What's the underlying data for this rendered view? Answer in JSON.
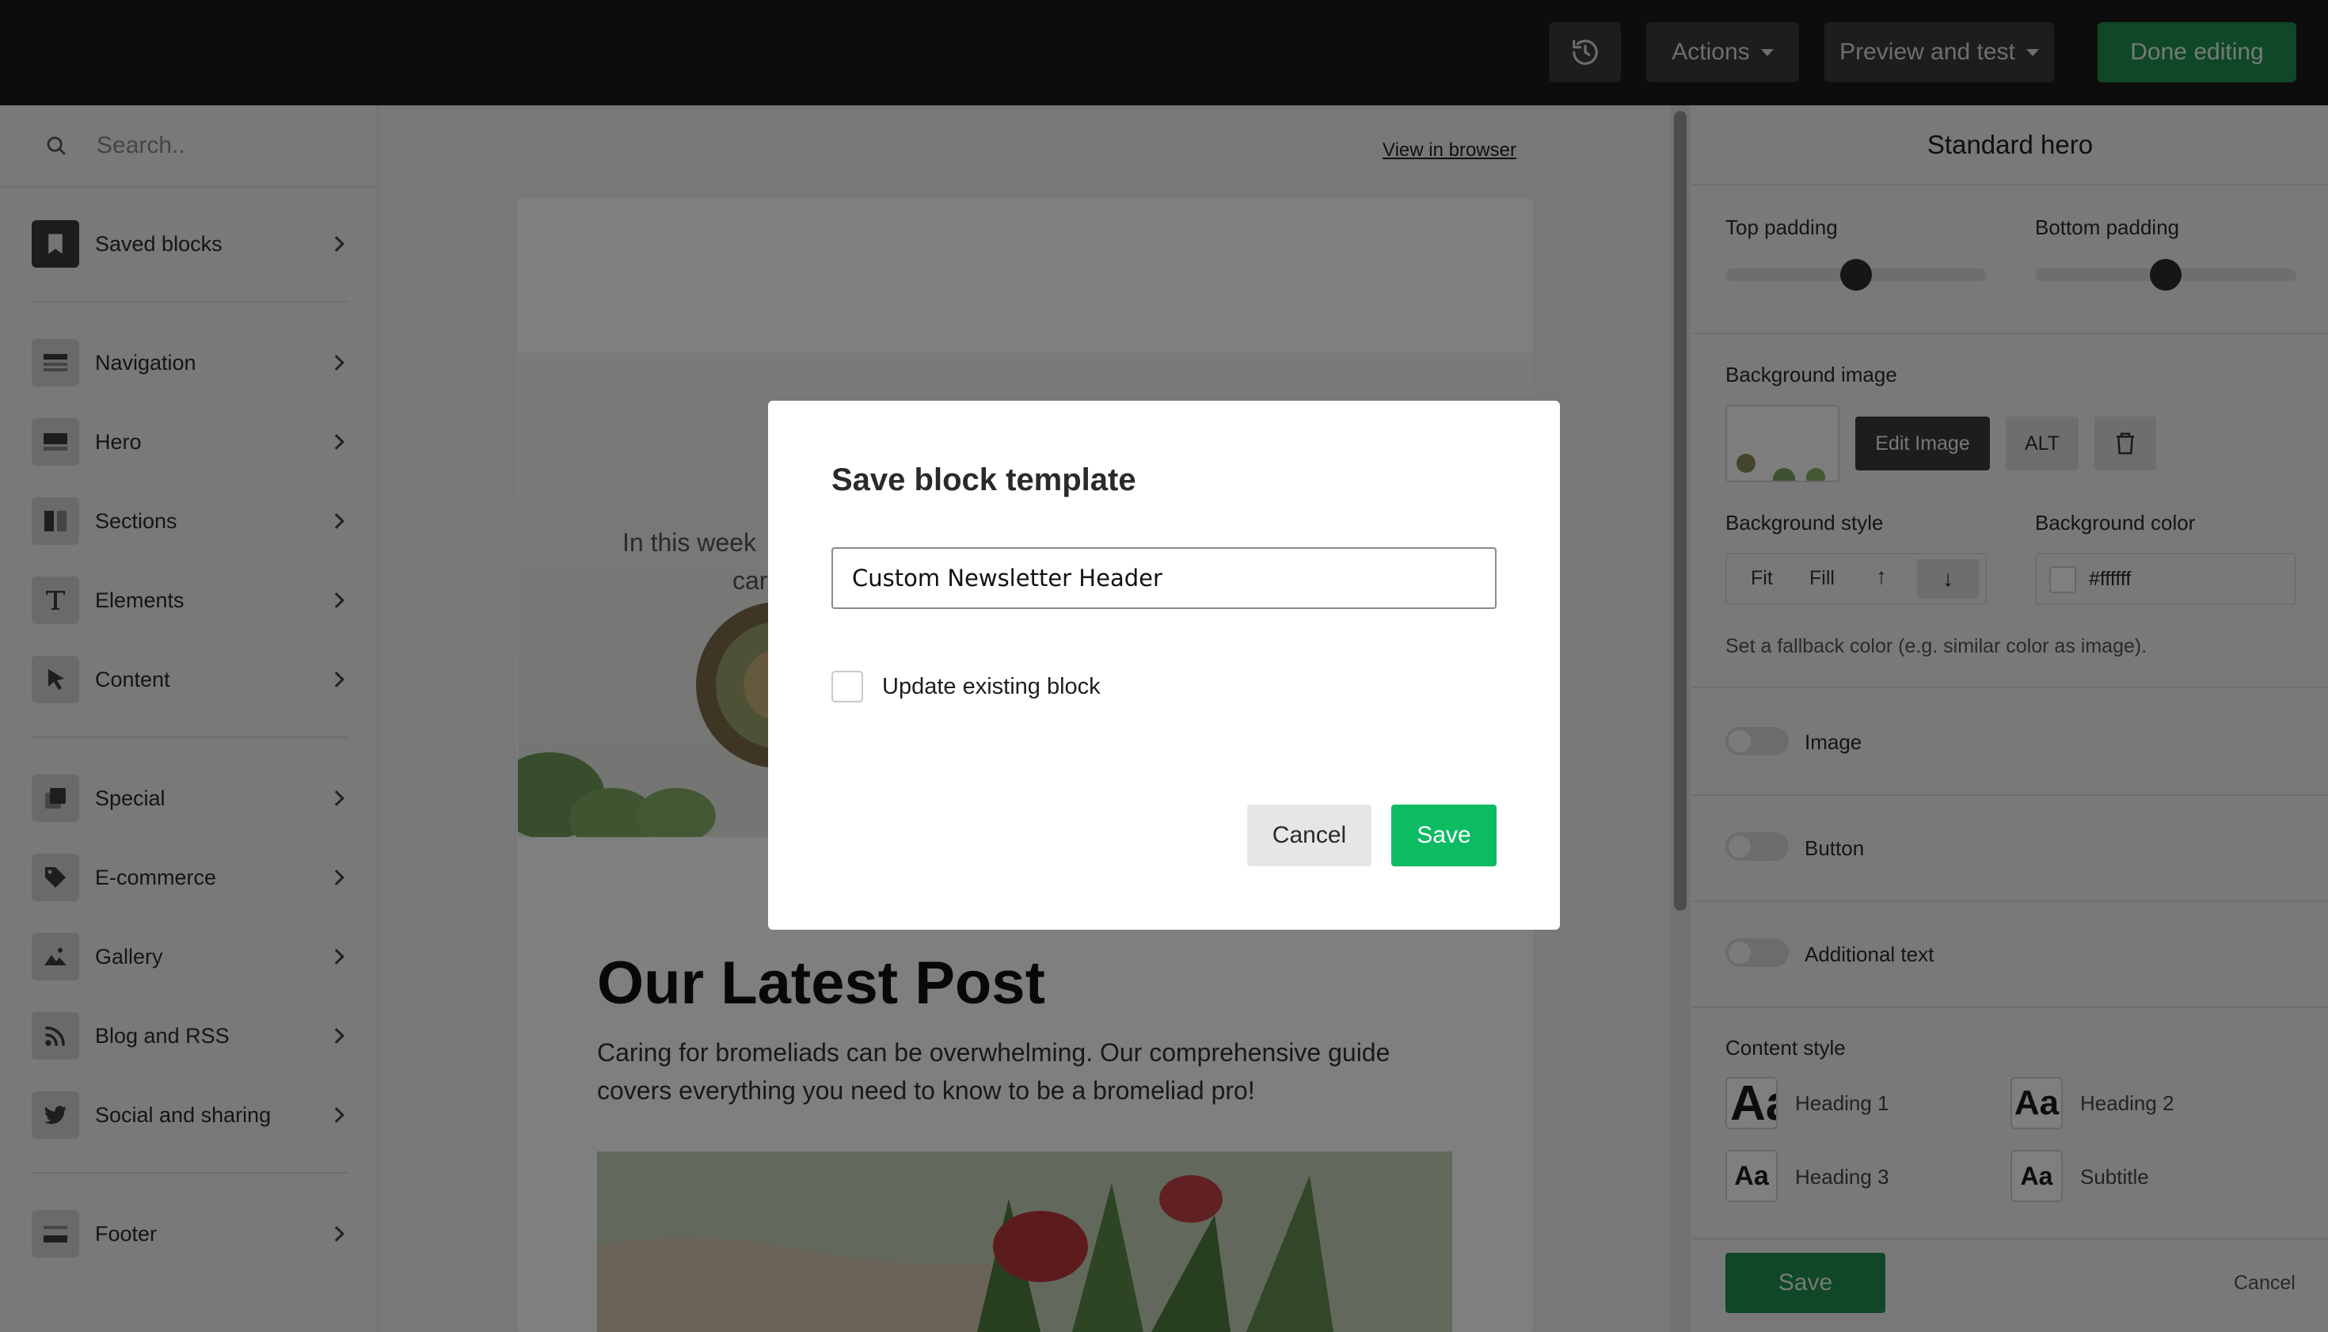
{
  "topbar": {
    "actions_label": "Actions",
    "preview_label": "Preview and test",
    "done_label": "Done editing"
  },
  "sidebar": {
    "search_placeholder": "Search..",
    "items": [
      {
        "label": "Saved blocks",
        "icon": "bookmark-icon"
      },
      {
        "label": "Navigation",
        "icon": "navigation-block-icon"
      },
      {
        "label": "Hero",
        "icon": "hero-block-icon"
      },
      {
        "label": "Sections",
        "icon": "sections-block-icon"
      },
      {
        "label": "Elements",
        "icon": "text-t-icon"
      },
      {
        "label": "Content",
        "icon": "cursor-icon"
      },
      {
        "label": "Special",
        "icon": "special-block-icon"
      },
      {
        "label": "E-commerce",
        "icon": "tag-icon"
      },
      {
        "label": "Gallery",
        "icon": "image-mountain-icon"
      },
      {
        "label": "Blog and RSS",
        "icon": "rss-icon"
      },
      {
        "label": "Social and sharing",
        "icon": "twitter-bird-icon"
      },
      {
        "label": "Footer",
        "icon": "footer-block-icon"
      }
    ]
  },
  "canvas": {
    "view_in_browser": "View in browser",
    "hero_text_line1": "In this week",
    "hero_text_line2": "car",
    "post_title": "Our Latest Post",
    "post_body_line1": "Caring for bromeliads can be overwhelming. Our comprehensive guide",
    "post_body_line2": "covers everything you need to know to be a bromeliad pro!"
  },
  "panel": {
    "title": "Standard hero",
    "top_padding_label": "Top padding",
    "top_padding_value": 0.5,
    "bottom_padding_label": "Bottom padding",
    "bottom_padding_value": 0.5,
    "bg_image_label": "Background image",
    "edit_image_label": "Edit Image",
    "alt_label": "ALT",
    "bg_style_label": "Background style",
    "style_fit": "Fit",
    "style_fill": "Fill",
    "bg_color_label": "Background color",
    "bg_color_value": "#ffffff",
    "fallback_hint": "Set a fallback color (e.g. similar color as image).",
    "toggles": [
      {
        "label": "Image",
        "on": false
      },
      {
        "label": "Button",
        "on": false
      },
      {
        "label": "Additional text",
        "on": false
      }
    ],
    "content_style_label": "Content style",
    "styles": [
      {
        "sample": "Aa",
        "label": "Heading 1"
      },
      {
        "sample": "Aa",
        "label": "Heading 2"
      },
      {
        "sample": "Aa",
        "label": "Heading 3"
      },
      {
        "sample": "Aa",
        "label": "Subtitle"
      }
    ],
    "save_label": "Save",
    "cancel_label": "Cancel"
  },
  "modal": {
    "title": "Save block template",
    "input_value": "Custom Newsletter Header",
    "checkbox_label": "Update existing block",
    "checkbox_checked": false,
    "cancel_label": "Cancel",
    "save_label": "Save"
  },
  "colors": {
    "accent_green": "#0dbb63",
    "done_green": "#1f8f4e",
    "topbar_bg": "#1b1b1b"
  }
}
